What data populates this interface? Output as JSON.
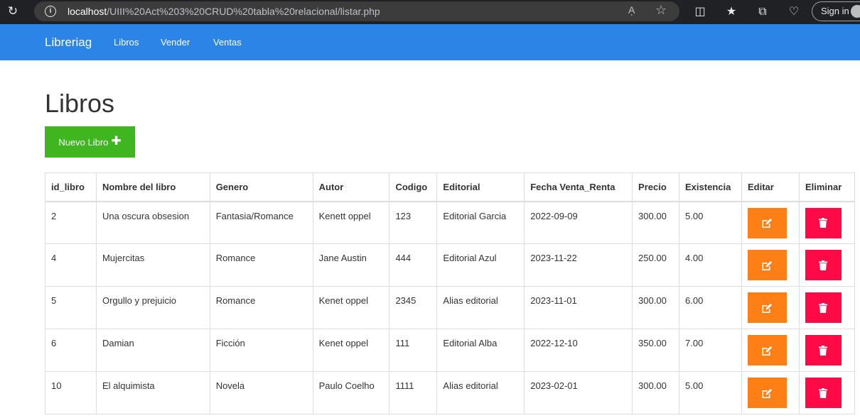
{
  "browser": {
    "url_host": "localhost",
    "url_path": "/UIII%20Act%203%20CRUD%20tabla%20relacional/listar.php",
    "read_aloud_label": "Aͅ",
    "signin_label": "Sign in"
  },
  "navbar": {
    "brand": "Libreriag",
    "links": [
      "Libros",
      "Vender",
      "Ventas"
    ]
  },
  "page": {
    "title": "Libros",
    "new_button_label": "Nuevo Libro"
  },
  "table": {
    "headers": [
      "id_libro",
      "Nombre del libro",
      "Genero",
      "Autor",
      "Codigo",
      "Editorial",
      "Fecha Venta_Renta",
      "Precio",
      "Existencia",
      "Editar",
      "Eliminar"
    ],
    "rows": [
      [
        "2",
        "Una oscura obsesion",
        "Fantasia/Romance",
        "Kenett oppel",
        "123",
        "Editorial Garcia",
        "2022-09-09",
        "300.00",
        "5.00"
      ],
      [
        "4",
        "Mujercitas",
        "Romance",
        "Jane Austin",
        "444",
        "Editorial Azul",
        "2023-11-22",
        "250.00",
        "4.00"
      ],
      [
        "5",
        "Orgullo y prejuicio",
        "Romance",
        "Kenet oppel",
        "2345",
        "Alias editorial",
        "2023-11-01",
        "300.00",
        "6.00"
      ],
      [
        "6",
        "Damian",
        "Ficción",
        "Kenet oppel",
        "111",
        "Editorial Alba",
        "2022-12-10",
        "350.00",
        "7.00"
      ],
      [
        "10",
        "El alquimista",
        "Novela",
        "Paulo Coelho",
        "1111",
        "Alias editorial",
        "2023-02-01",
        "300.00",
        "5.00"
      ]
    ]
  },
  "colors": {
    "navbar": "#2c84e6",
    "new_button": "#3fb61f",
    "edit_button": "#ff7f17",
    "delete_button": "#ff0a46"
  },
  "icons": {
    "edit": "edit-icon",
    "delete": "trash-icon",
    "add": "plus-icon"
  }
}
